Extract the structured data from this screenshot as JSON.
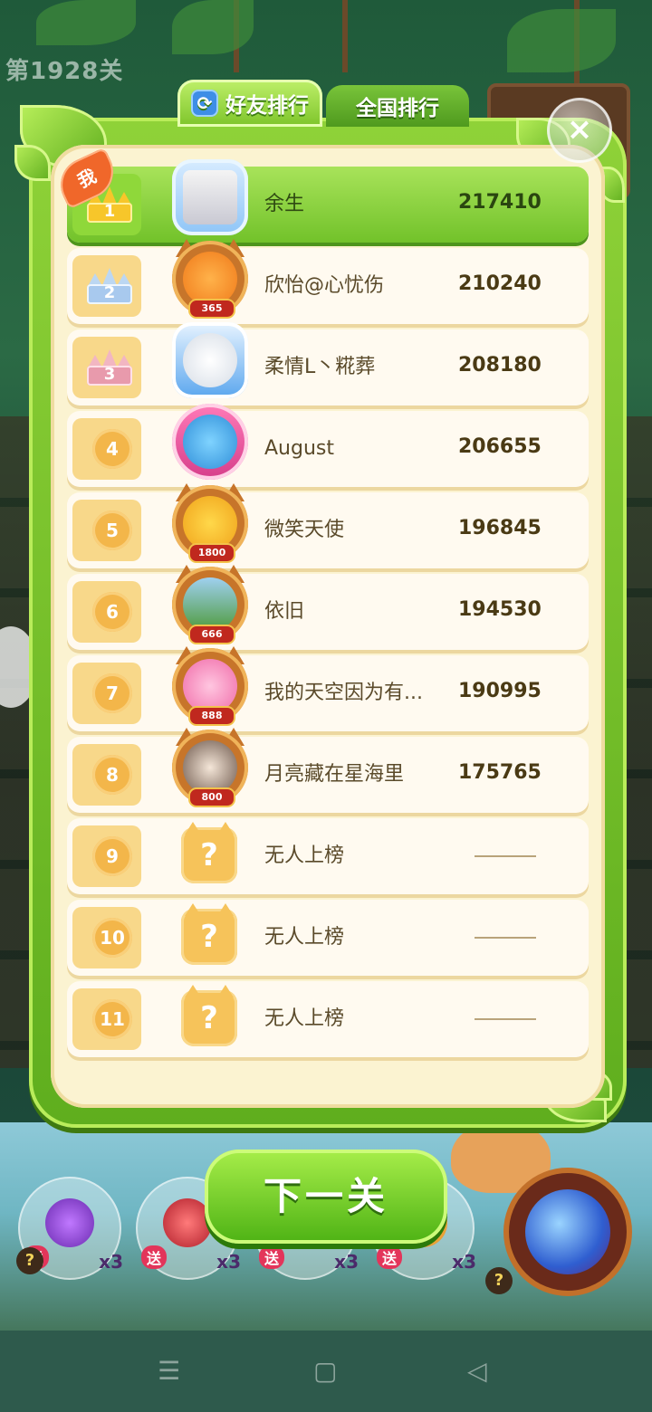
{
  "level_label": "第1928关",
  "tabs": [
    {
      "label": "好友排行",
      "active": true,
      "icon": "refresh-icon"
    },
    {
      "label": "全国排行",
      "active": false
    }
  ],
  "me_tag": "我",
  "close_icon": "×",
  "ranks": [
    {
      "rank": "1",
      "name": "余生",
      "score": "217410",
      "is_me": true,
      "crown": "gold"
    },
    {
      "rank": "2",
      "name": "欣怡@心忧伤",
      "score": "210240",
      "is_me": false,
      "crown": "silver",
      "level_badge": "365"
    },
    {
      "rank": "3",
      "name": "柔情L丶糀葬",
      "score": "208180",
      "is_me": false,
      "crown": "bronze"
    },
    {
      "rank": "4",
      "name": "August",
      "score": "206655",
      "is_me": false
    },
    {
      "rank": "5",
      "name": "微笑天使",
      "score": "196845",
      "is_me": false,
      "level_badge": "1800"
    },
    {
      "rank": "6",
      "name": "依旧",
      "score": "194530",
      "is_me": false,
      "level_badge": "666"
    },
    {
      "rank": "7",
      "name": "我的天空因为有...",
      "score": "190995",
      "is_me": false,
      "level_badge": "888"
    },
    {
      "rank": "8",
      "name": "月亮藏在星海里",
      "score": "175765",
      "is_me": false,
      "level_badge": "800"
    },
    {
      "rank": "9",
      "name": "无人上榜",
      "score": "",
      "is_me": false,
      "empty": true
    },
    {
      "rank": "10",
      "name": "无人上榜",
      "score": "",
      "is_me": false,
      "empty": true
    },
    {
      "rank": "11",
      "name": "无人上榜",
      "score": "",
      "is_me": false,
      "empty": true
    }
  ],
  "next_button": "下一关",
  "boosters": [
    {
      "send": "送",
      "qty": "x3"
    },
    {
      "send": "送",
      "qty": "x3"
    },
    {
      "send": "送",
      "qty": "x3"
    },
    {
      "send": "送",
      "qty": "x3"
    }
  ],
  "booster_help": "?",
  "colors": {
    "panel_green": "#7dc42a",
    "row_bg": "#fffaf0",
    "rank_bg": "#f8d88a",
    "me_row": "#8fd83a",
    "me_tag": "#f0672a"
  }
}
